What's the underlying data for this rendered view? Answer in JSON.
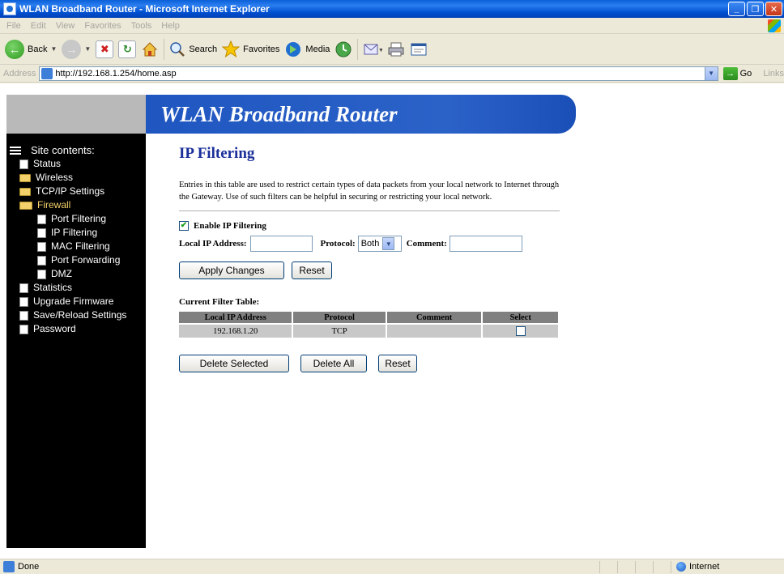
{
  "window": {
    "title": "WLAN Broadband Router - Microsoft Internet Explorer",
    "buttons": {
      "minimize": "_",
      "restore": "❐",
      "close": "✕"
    }
  },
  "menu": [
    "File",
    "Edit",
    "View",
    "Favorites",
    "Tools",
    "Help"
  ],
  "toolbar": {
    "back": "Back",
    "search": "Search",
    "favorites": "Favorites",
    "media": "Media"
  },
  "address": {
    "label": "Address",
    "url": "http://192.168.1.254/home.asp",
    "go": "Go",
    "links": "Links"
  },
  "banner": {
    "title": "WLAN Broadband Router"
  },
  "sidebar": {
    "root": "Site contents:",
    "items": [
      {
        "label": "Status",
        "type": "doc",
        "level": 1
      },
      {
        "label": "Wireless",
        "type": "folder",
        "level": 1
      },
      {
        "label": "TCP/IP Settings",
        "type": "folder",
        "level": 1
      },
      {
        "label": "Firewall",
        "type": "open-folder",
        "level": 1
      },
      {
        "label": "Port Filtering",
        "type": "doc",
        "level": 2
      },
      {
        "label": "IP Filtering",
        "type": "doc",
        "level": 2
      },
      {
        "label": "MAC Filtering",
        "type": "doc",
        "level": 2
      },
      {
        "label": "Port Forwarding",
        "type": "doc",
        "level": 2
      },
      {
        "label": "DMZ",
        "type": "doc",
        "level": 2
      },
      {
        "label": "Statistics",
        "type": "doc",
        "level": 1
      },
      {
        "label": "Upgrade Firmware",
        "type": "doc",
        "level": 1
      },
      {
        "label": "Save/Reload Settings",
        "type": "doc",
        "level": 1
      },
      {
        "label": "Password",
        "type": "doc",
        "level": 1
      }
    ]
  },
  "page": {
    "title": "IP Filtering",
    "intro": "Entries in this table are used to restrict certain types of data packets from your local network to Internet through the Gateway. Use of such filters can be helpful in securing or restricting your local network.",
    "enable_label": "Enable IP Filtering",
    "enable_checked": true,
    "local_ip_label": "Local IP Address:",
    "local_ip_value": "",
    "protocol_label": "Protocol:",
    "protocol_value": "Both",
    "comment_label": "Comment:",
    "comment_value": "",
    "apply_button": "Apply Changes",
    "reset_button": "Reset",
    "table_title": "Current Filter Table:",
    "table_headers": [
      "Local IP Address",
      "Protocol",
      "Comment",
      "Select"
    ],
    "table_rows": [
      {
        "ip": "192.168.1.20",
        "protocol": "TCP",
        "comment": "",
        "selected": false
      }
    ],
    "delete_selected_button": "Delete Selected",
    "delete_all_button": "Delete All",
    "reset2_button": "Reset"
  },
  "status": {
    "text": "Done",
    "zone": "Internet"
  }
}
